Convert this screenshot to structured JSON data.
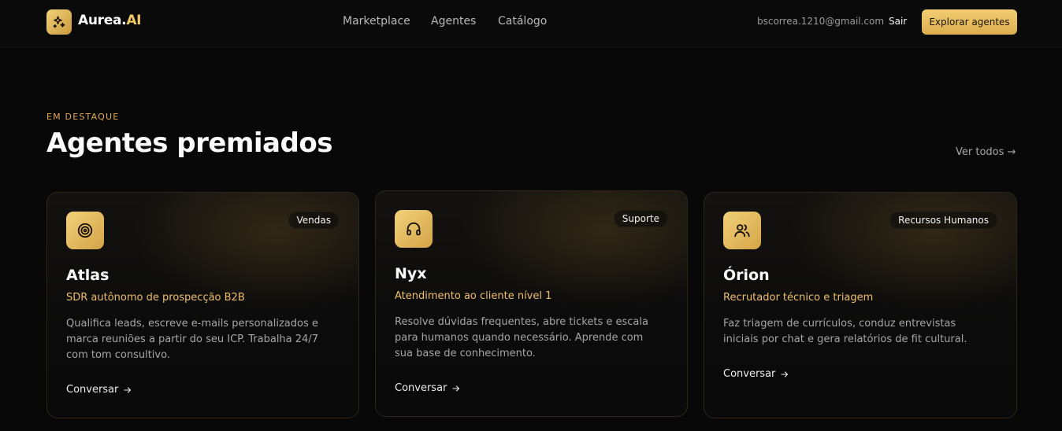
{
  "nav": {
    "brand": "Aurea.",
    "brand_accent": "AI",
    "links": [
      "Marketplace",
      "Agentes",
      "Catálogo"
    ],
    "email": "bscorrea.1210@gmail.com",
    "logout": "Sair",
    "cta": "Explorar agentes"
  },
  "section": {
    "eyebrow": "EM DESTAQUE",
    "title": "Agentes premiados",
    "view_all": "Ver todos →"
  },
  "cards": [
    {
      "icon": "target-icon",
      "badge": "Vendas",
      "title": "Atlas",
      "subtitle": "SDR autônomo de prospecção B2B",
      "description": "Qualifica leads, escreve e-mails personalizados e marca reuniões a partir do seu ICP. Trabalha 24/7 com tom consultivo.",
      "cta": "Conversar"
    },
    {
      "icon": "headphones-icon",
      "badge": "Suporte",
      "title": "Nyx",
      "subtitle": "Atendimento ao cliente nível 1",
      "description": "Resolve dúvidas frequentes, abre tickets e escala para humanos quando necessário. Aprende com sua base de conhecimento.",
      "cta": "Conversar"
    },
    {
      "icon": "users-icon",
      "badge": "Recursos Humanos",
      "title": "Órion",
      "subtitle": "Recrutador técnico e triagem",
      "description": "Faz triagem de currículos, conduz entrevistas iniciais por chat e gera relatórios de fit cultural.",
      "cta": "Conversar"
    }
  ],
  "colors": {
    "accent": "#f0c868",
    "accent_text": "#f0be6a",
    "background": "#080808",
    "card_border": "#2e2718"
  }
}
